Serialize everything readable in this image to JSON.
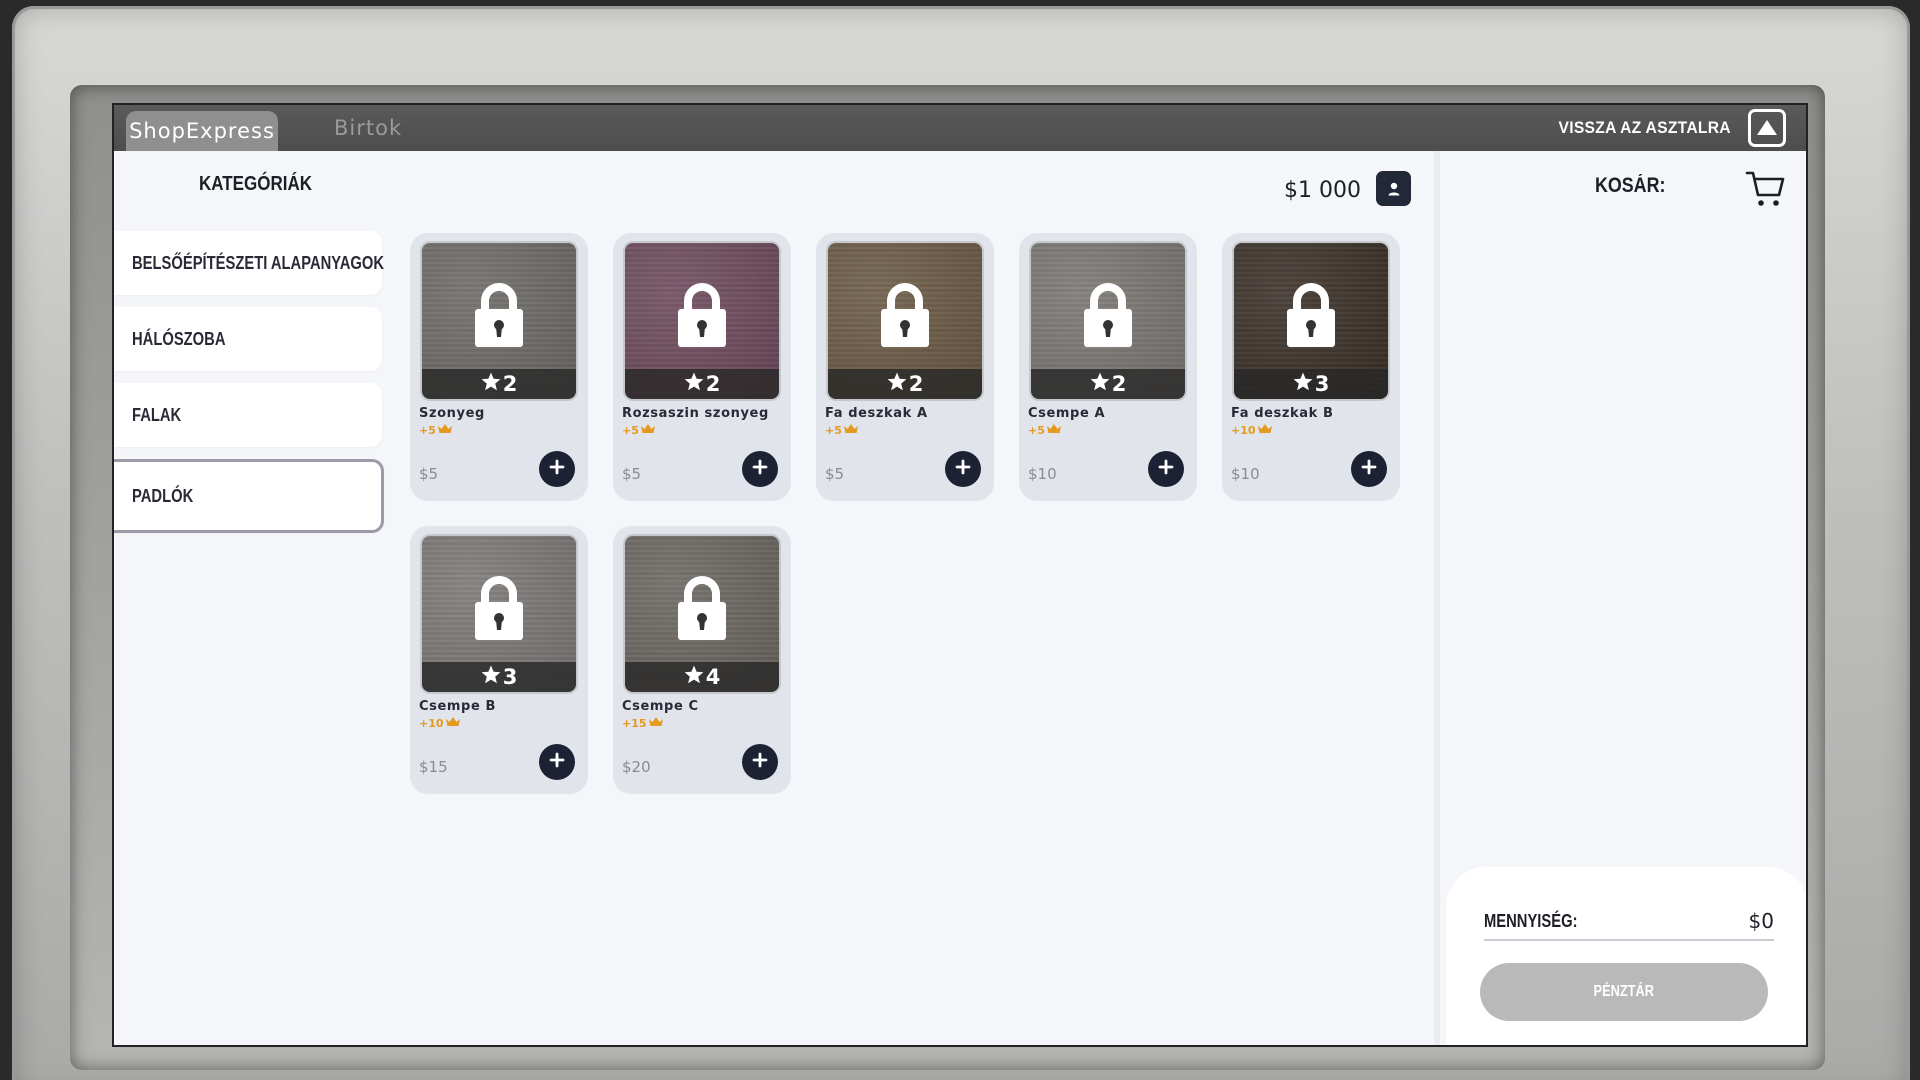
{
  "topbar": {
    "tabs": [
      {
        "label": "ShopExpress",
        "active": true
      },
      {
        "label": "Birtok",
        "active": false
      }
    ],
    "back_label": "VISSZA AZ ASZTALRA",
    "back_icon": "eject-up-icon"
  },
  "header": {
    "categories_title": "KATEGÓRIÁK",
    "balance": "$1 000",
    "profile_icon": "user-icon"
  },
  "categories": [
    {
      "label": "BELSŐÉPÍTÉSZETI ALAPANYAGOK",
      "selected": false
    },
    {
      "label": "HÁLÓSZOBA",
      "selected": false
    },
    {
      "label": "FALAK",
      "selected": false
    },
    {
      "label": "PADLÓK",
      "selected": true
    }
  ],
  "products": [
    {
      "name": "Szonyeg",
      "level": "2",
      "bonus": "+5",
      "price": "$5",
      "color": "#6d6a66",
      "locked": true
    },
    {
      "name": "Rozsaszin szonyeg",
      "level": "2",
      "bonus": "+5",
      "price": "$5",
      "color": "#6e4a5c",
      "locked": true
    },
    {
      "name": "Fa deszkak A",
      "level": "2",
      "bonus": "+5",
      "price": "$5",
      "color": "#6a5a44",
      "locked": true
    },
    {
      "name": "Csempe A",
      "level": "2",
      "bonus": "+5",
      "price": "$10",
      "color": "#7a7672",
      "locked": true
    },
    {
      "name": "Fa deszkak B",
      "level": "3",
      "bonus": "+10",
      "price": "$10",
      "color": "#3b3029",
      "locked": true
    },
    {
      "name": "Csempe B",
      "level": "3",
      "bonus": "+10",
      "price": "$15",
      "color": "#7b7876",
      "locked": true
    },
    {
      "name": "Csempe C",
      "level": "4",
      "bonus": "+15",
      "price": "$20",
      "color": "#6b6661",
      "locked": true
    }
  ],
  "cart": {
    "title": "KOSÁR:",
    "icon": "cart-icon",
    "quantity_label": "MENNYISÉG:",
    "quantity_value": "$0",
    "checkout_label": "PÉNZTÁR"
  },
  "colors": {
    "accent_dark": "#1c2233",
    "bonus_orange": "#e49a1f",
    "checkout_disabled": "#b9b9b9"
  }
}
